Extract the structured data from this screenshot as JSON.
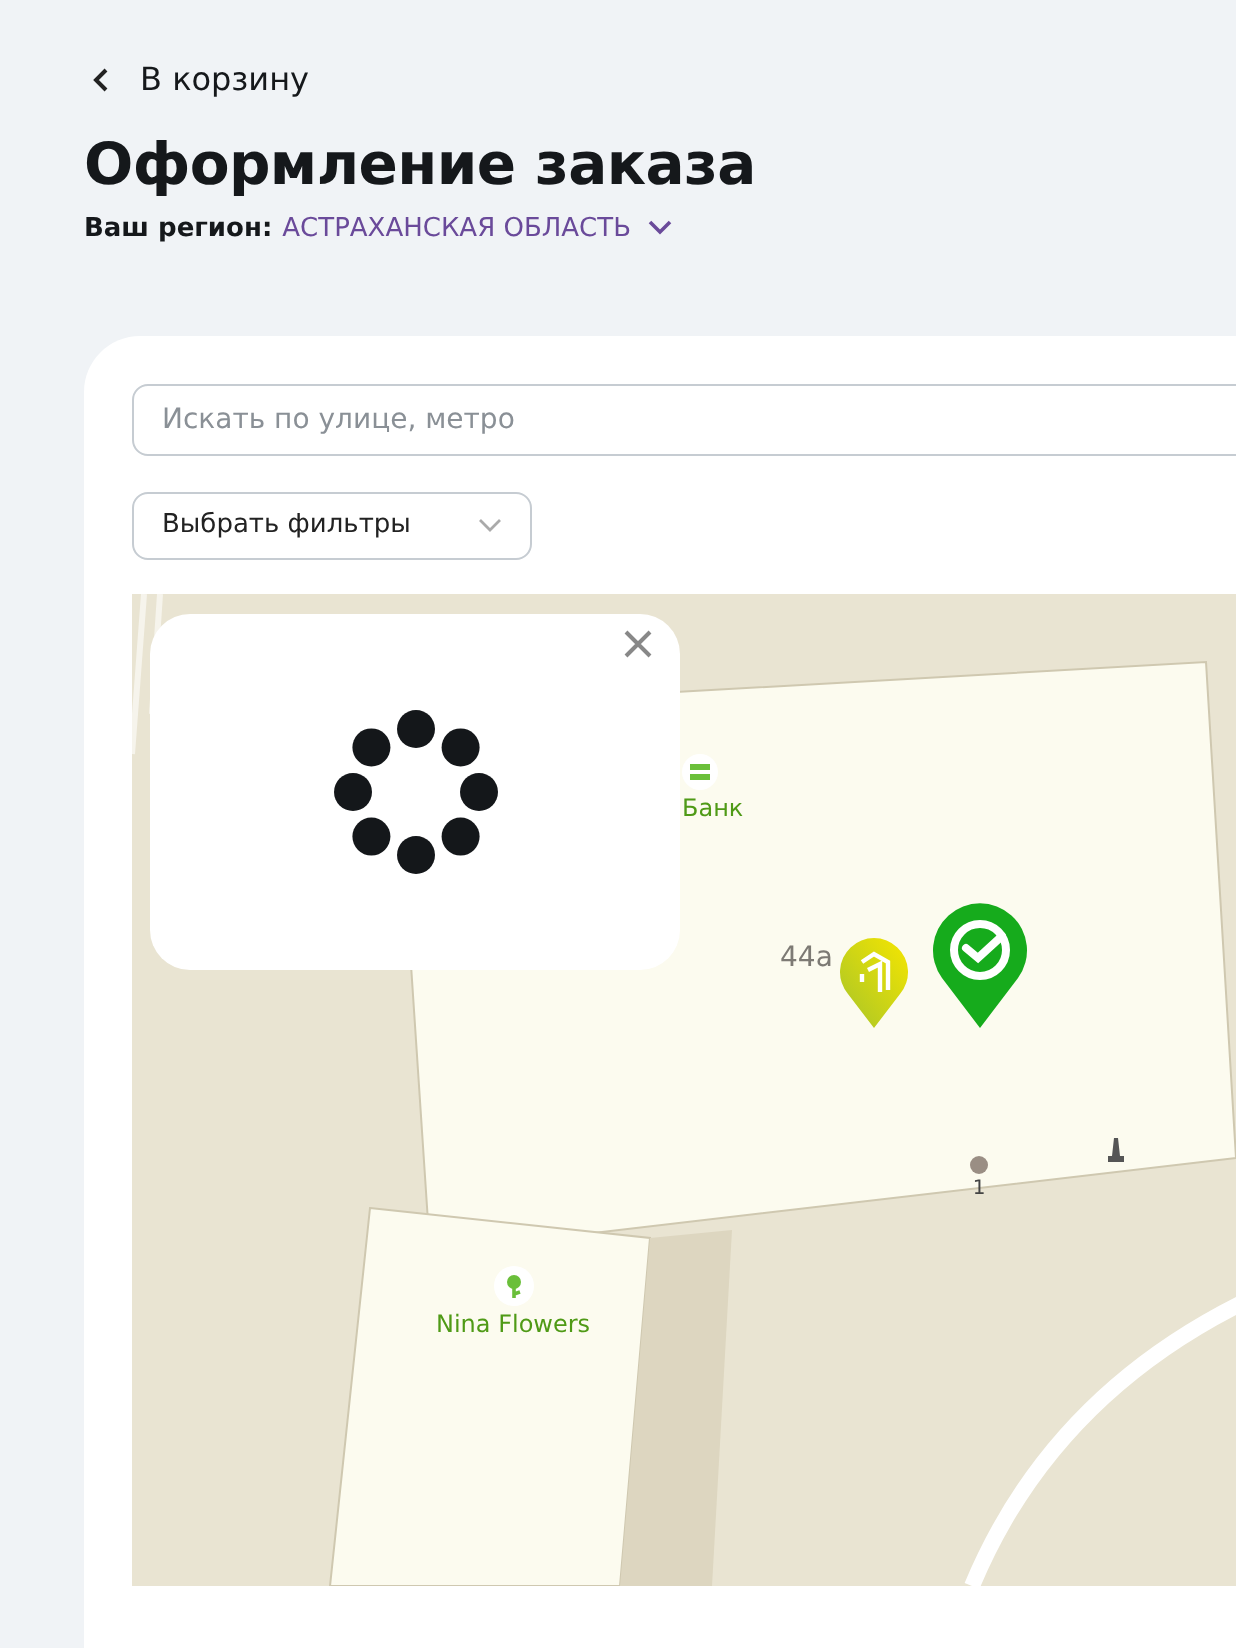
{
  "back_link": {
    "label": "В корзину"
  },
  "title": "Оформление заказа",
  "region": {
    "label": "Ваш регион:",
    "value": "АСТРАХАНСКАЯ ОБЛАСТЬ"
  },
  "search": {
    "placeholder": "Искать по улице, метро"
  },
  "filter": {
    "label": "Выбрать фильтры"
  },
  "map": {
    "labels": [
      {
        "kind": "poi",
        "text": "Банк"
      },
      {
        "kind": "address",
        "text": "44а"
      },
      {
        "kind": "entrance",
        "text": "1"
      },
      {
        "kind": "poi",
        "text": "Nina Flowers"
      }
    ]
  }
}
